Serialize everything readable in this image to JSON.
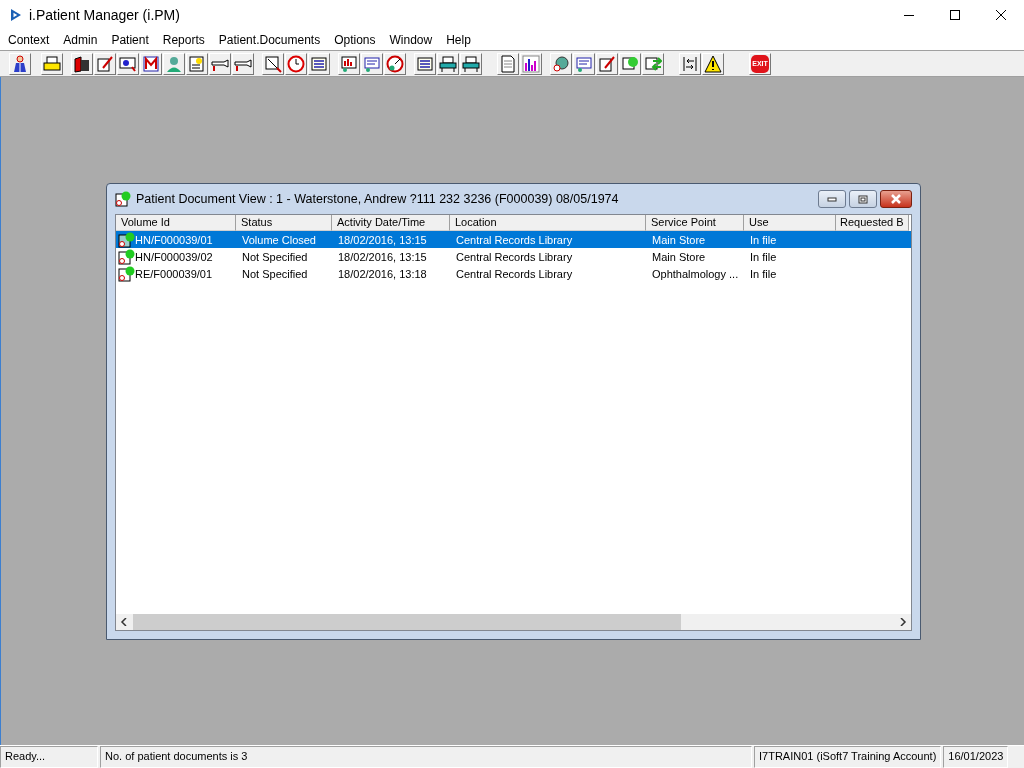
{
  "window": {
    "title": "i.Patient Manager (i.PM)"
  },
  "menu": [
    "Context",
    "Admin",
    "Patient",
    "Reports",
    "Patient.Documents",
    "Options",
    "Window",
    "Help"
  ],
  "toolbar": {
    "exit_label": "EXIT"
  },
  "document_window": {
    "title": "Patient Document View : 1 - Waterstone, Andrew ?111 232 3236 (F000039) 08/05/1974",
    "table": {
      "columns": [
        "Volume Id",
        "Status",
        "Activity Date/Time",
        "Location",
        "Service Point",
        "Use",
        "Requested B"
      ],
      "rows": [
        {
          "selected": true,
          "cells": [
            "HN/F000039/01",
            "Volume Closed",
            "18/02/2016, 13:15",
            "Central Records Library",
            "Main Store",
            "In file",
            ""
          ]
        },
        {
          "selected": false,
          "cells": [
            "HN/F000039/02",
            "Not Specified",
            "18/02/2016, 13:15",
            "Central Records Library",
            "Main Store",
            "In file",
            ""
          ]
        },
        {
          "selected": false,
          "cells": [
            "RE/F000039/01",
            "Not Specified",
            "18/02/2016, 13:18",
            "Central Records Library",
            "Ophthalmology ...",
            "In file",
            ""
          ]
        }
      ]
    }
  },
  "status_bar": [
    "Ready...",
    "No. of patient documents is 3",
    "I7TRAIN01 (iSoft7 Training Account)",
    "16/01/2023"
  ]
}
